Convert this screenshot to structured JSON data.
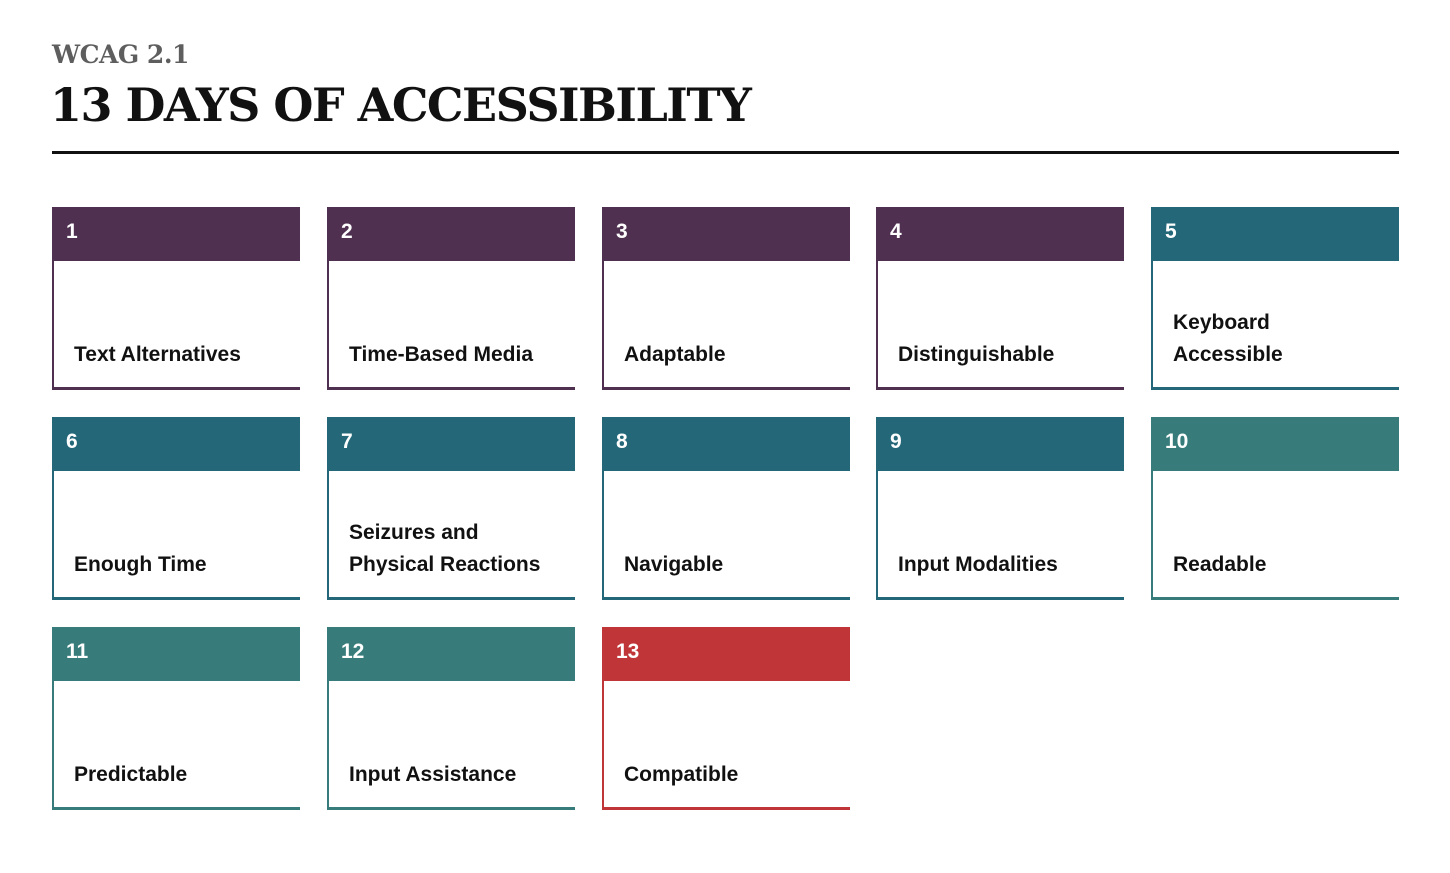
{
  "header": {
    "subtitle": "WCAG 2.1",
    "title": "13 DAYS OF ACCESSIBILITY"
  },
  "colors": {
    "purple": "#4f3050",
    "teal_dark": "#236778",
    "teal_light": "#377c7b",
    "red": "#bf3538"
  },
  "cards": [
    {
      "number": "1",
      "label": "Text Alternatives",
      "color": "purple"
    },
    {
      "number": "2",
      "label": "Time-Based Media",
      "color": "purple"
    },
    {
      "number": "3",
      "label": "Adaptable",
      "color": "purple"
    },
    {
      "number": "4",
      "label": "Distinguishable",
      "color": "purple"
    },
    {
      "number": "5",
      "label": "Keyboard Accessible",
      "label_lines": [
        "Keyboard",
        "Accessible"
      ],
      "color": "teal_dark"
    },
    {
      "number": "6",
      "label": "Enough Time",
      "color": "teal_dark"
    },
    {
      "number": "7",
      "label": "Seizures and Physical Reactions",
      "label_lines": [
        "Seizures and",
        "Physical Reactions"
      ],
      "color": "teal_dark"
    },
    {
      "number": "8",
      "label": "Navigable",
      "color": "teal_dark"
    },
    {
      "number": "9",
      "label": "Input Modalities",
      "color": "teal_dark"
    },
    {
      "number": "10",
      "label": "Readable",
      "color": "teal_light"
    },
    {
      "number": "11",
      "label": "Predictable",
      "color": "teal_light"
    },
    {
      "number": "12",
      "label": "Input Assistance",
      "color": "teal_light"
    },
    {
      "number": "13",
      "label": "Compatible",
      "color": "red"
    }
  ]
}
